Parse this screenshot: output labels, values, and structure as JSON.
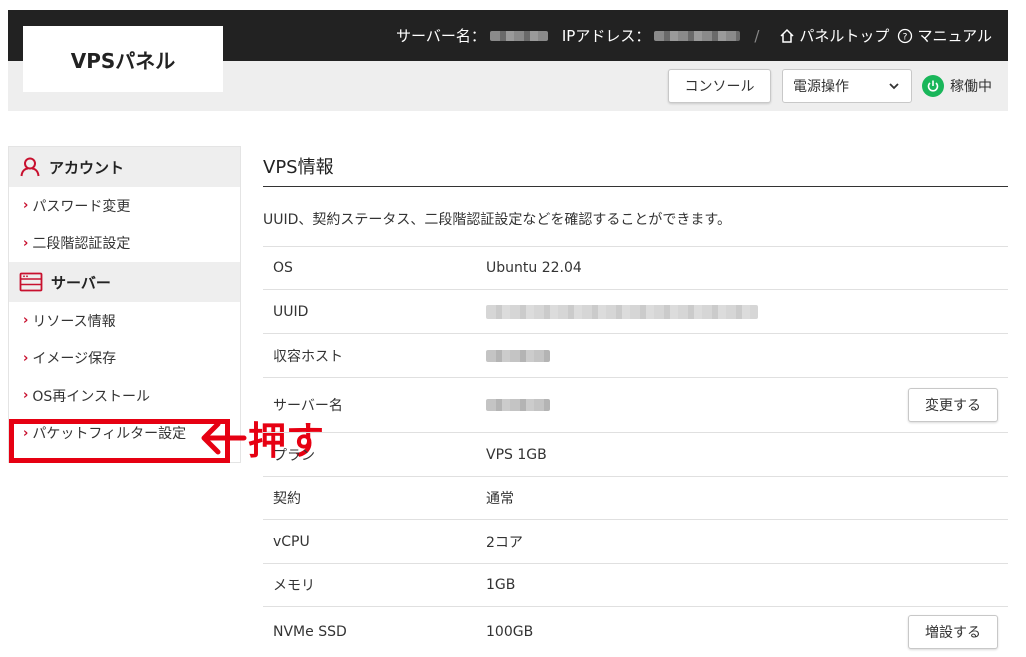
{
  "header": {
    "logo": "VPSパネル",
    "server_name_label": "サーバー名：",
    "ip_label": "IPアドレス：",
    "separator": "/",
    "panel_top": "パネルトップ",
    "manual": "マニュアル",
    "console_button": "コンソール",
    "power_select": {
      "selected": "電源操作"
    },
    "status": "稼働中",
    "colors": {
      "status": "#19b65a",
      "topbar": "#222222"
    }
  },
  "sidebar": {
    "account_heading": "アカウント",
    "account_items": [
      {
        "label": "パスワード変更"
      },
      {
        "label": "二段階認証設定"
      }
    ],
    "server_heading": "サーバー",
    "server_items": [
      {
        "label": "リソース情報"
      },
      {
        "label": "イメージ保存"
      },
      {
        "label": "OS再インストール"
      },
      {
        "label": "パケットフィルター設定"
      }
    ],
    "arrow": "›"
  },
  "annotation": {
    "text": "押す",
    "color": "#e60012"
  },
  "main": {
    "title": "VPS情報",
    "description": "UUID、契約ステータス、二段階認証設定などを確認することができます。",
    "rows": [
      {
        "key": "OS",
        "value": "Ubuntu 22.04"
      },
      {
        "key": "UUID",
        "value": ""
      },
      {
        "key": "収容ホスト",
        "value": ""
      },
      {
        "key": "サーバー名",
        "value": "",
        "action": "変更する"
      },
      {
        "key": "プラン",
        "value": "VPS 1GB"
      },
      {
        "key": "契約",
        "value": "通常"
      },
      {
        "key": "vCPU",
        "value": "2コア"
      },
      {
        "key": "メモリ",
        "value": "1GB"
      },
      {
        "key": "NVMe SSD",
        "value": "100GB",
        "action": "増設する"
      }
    ]
  }
}
